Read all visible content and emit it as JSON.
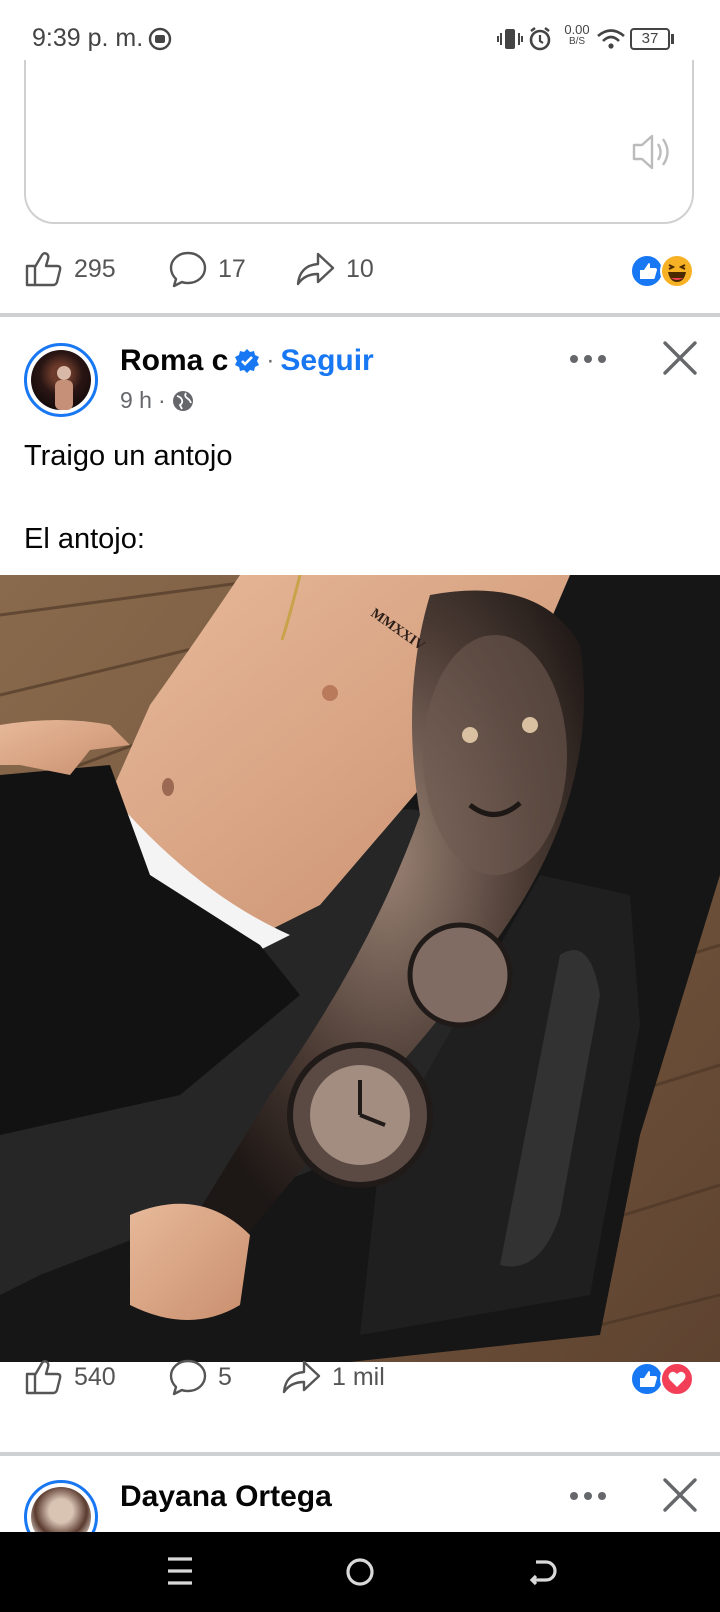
{
  "status_bar": {
    "time": "9:39 p. m.",
    "net_speed_value": "0.00",
    "net_speed_unit": "B/S",
    "battery": "37"
  },
  "prev_post": {
    "likes": "295",
    "comments": "17",
    "shares": "10"
  },
  "post": {
    "author": "Roma c",
    "separator": "·",
    "follow_label": "Seguir",
    "time": "9 h",
    "meta_separator": "·",
    "text_line1": "Traigo un antojo",
    "text_line2": "El antojo:",
    "photo_text": "MMXXIV",
    "likes": "540",
    "comments": "5",
    "shares": "1 mil"
  },
  "next_post": {
    "author": "Dayana Ortega"
  },
  "colors": {
    "accent": "#1877f2",
    "love": "#f33e58",
    "haha": "#f7b125"
  }
}
